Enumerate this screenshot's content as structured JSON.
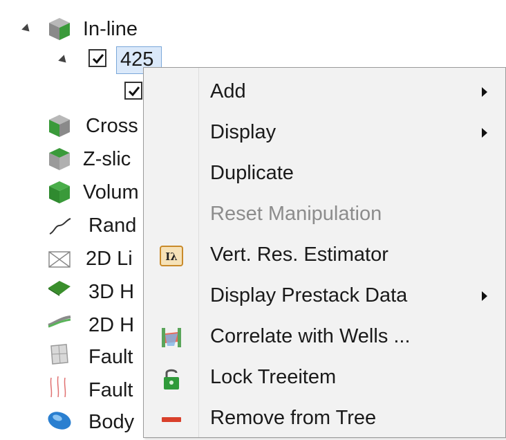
{
  "tree": {
    "root": {
      "label": "In-line"
    },
    "child": {
      "label": "425"
    },
    "items": [
      {
        "label": "Cross"
      },
      {
        "label": "Z-slic"
      },
      {
        "label": "Volum"
      },
      {
        "label": "Rand"
      },
      {
        "label": "2D Li"
      },
      {
        "label": "3D H"
      },
      {
        "label": "2D H"
      },
      {
        "label": "Fault"
      },
      {
        "label": "Fault"
      },
      {
        "label": "Body"
      }
    ]
  },
  "context_menu": {
    "items": [
      {
        "label": "Add",
        "submenu": true,
        "enabled": true
      },
      {
        "label": "Display",
        "submenu": true,
        "enabled": true
      },
      {
        "label": "Duplicate",
        "submenu": false,
        "enabled": true
      },
      {
        "label": "Reset Manipulation",
        "submenu": false,
        "enabled": false
      },
      {
        "label": "Vert. Res. Estimator",
        "submenu": false,
        "enabled": true,
        "icon": "vert-res-estimator-icon"
      },
      {
        "label": "Display Prestack Data",
        "submenu": true,
        "enabled": true
      },
      {
        "label": "Correlate with Wells ...",
        "submenu": false,
        "enabled": true,
        "icon": "correlate-wells-icon"
      },
      {
        "label": "Lock Treeitem",
        "submenu": false,
        "enabled": true,
        "icon": "lock-icon"
      },
      {
        "label": "Remove from Tree",
        "submenu": false,
        "enabled": true,
        "icon": "remove-icon"
      }
    ]
  },
  "colors": {
    "menu_bg": "#f2f2f2",
    "selection_bg": "#dbe9fa",
    "selection_border": "#7aa7d9",
    "disabled_text": "#8c8c8c",
    "cube_green": "#3a9a3a",
    "cube_gray": "#9a9a9a",
    "remove_red": "#d9402b"
  }
}
